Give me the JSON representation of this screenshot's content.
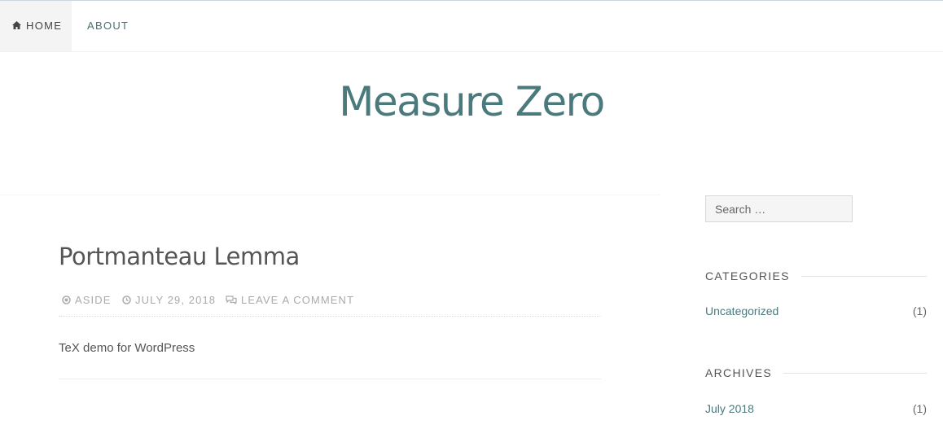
{
  "nav": {
    "items": [
      {
        "label": "HOME",
        "icon": "home-icon"
      },
      {
        "label": "ABOUT"
      }
    ]
  },
  "site": {
    "title": "Measure Zero"
  },
  "post": {
    "title": "Portmanteau Lemma",
    "meta": {
      "format": "ASIDE",
      "date": "JULY 29, 2018",
      "comments": "LEAVE A COMMENT"
    },
    "excerpt": "TeX demo for WordPress"
  },
  "sidebar": {
    "search": {
      "placeholder": "Search …"
    },
    "categories": {
      "title": "CATEGORIES",
      "items": [
        {
          "label": "Uncategorized",
          "count": "(1)"
        }
      ]
    },
    "archives": {
      "title": "ARCHIVES",
      "items": [
        {
          "label": "July 2018",
          "count": "(1)"
        }
      ]
    }
  },
  "colors": {
    "accent": "#4a7a7c",
    "text": "#555555",
    "meta": "#aaaaaa"
  }
}
